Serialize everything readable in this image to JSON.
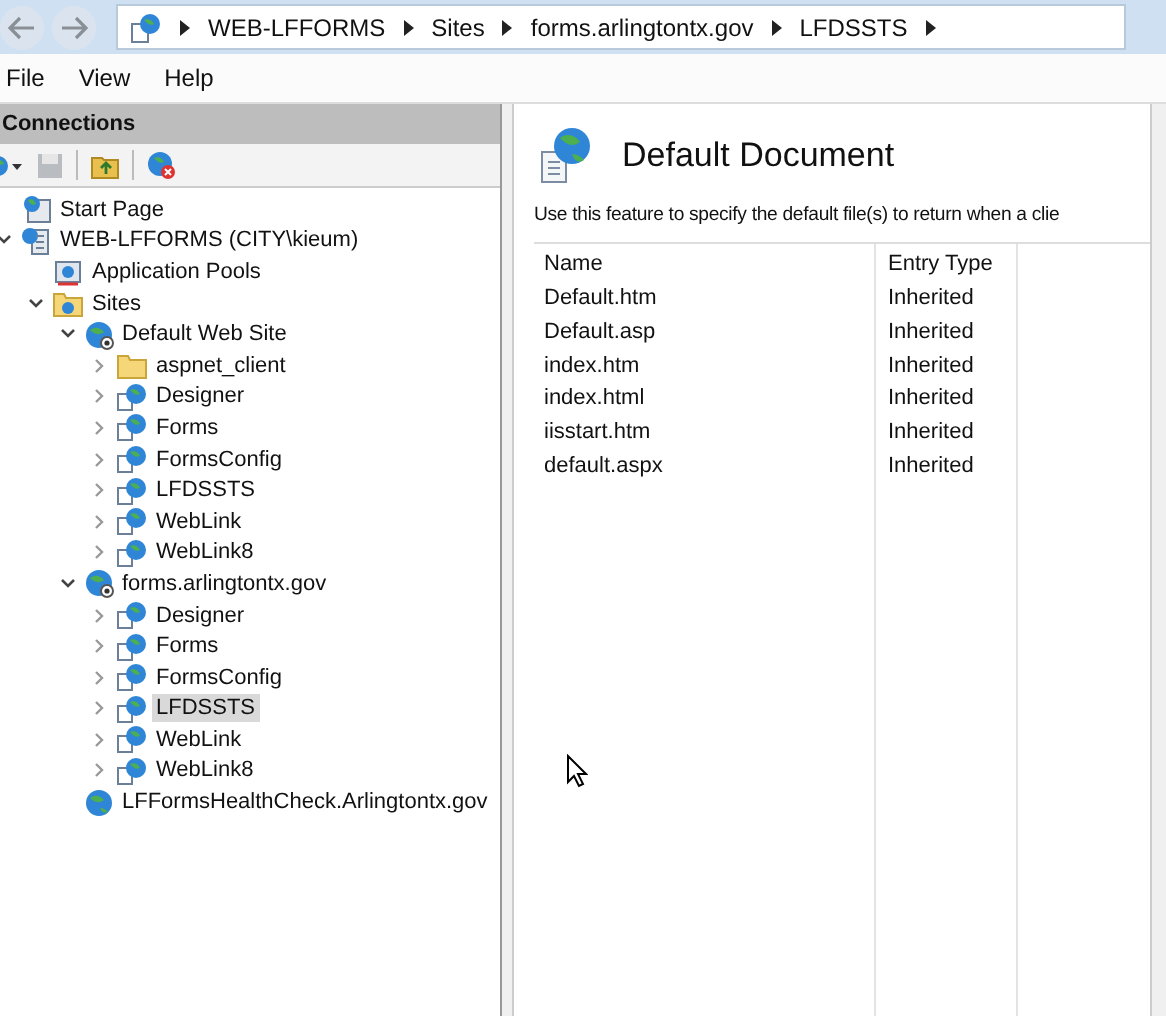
{
  "breadcrumb": [
    "WEB-LFFORMS",
    "Sites",
    "forms.arlingtontx.gov",
    "LFDSSTS"
  ],
  "menu": [
    "File",
    "View",
    "Help"
  ],
  "connections": {
    "title": "Connections",
    "tree": [
      {
        "label": "Start Page",
        "kind": "start",
        "selected": false
      },
      {
        "label": "WEB-LFFORMS (CITY\\kieum)",
        "kind": "server",
        "selected": false,
        "expanded": true,
        "children": [
          {
            "label": "Application Pools",
            "kind": "pools",
            "selected": false
          },
          {
            "label": "Sites",
            "kind": "sites",
            "selected": false,
            "expanded": true,
            "children": [
              {
                "label": "Default Web Site",
                "kind": "site",
                "selected": false,
                "expanded": true,
                "children": [
                  {
                    "label": "aspnet_client",
                    "kind": "folder",
                    "selected": false,
                    "expanded": false
                  },
                  {
                    "label": "Designer",
                    "kind": "app",
                    "selected": false,
                    "expanded": false
                  },
                  {
                    "label": "Forms",
                    "kind": "app",
                    "selected": false,
                    "expanded": false
                  },
                  {
                    "label": "FormsConfig",
                    "kind": "app",
                    "selected": false,
                    "expanded": false
                  },
                  {
                    "label": "LFDSSTS",
                    "kind": "app",
                    "selected": false,
                    "expanded": false
                  },
                  {
                    "label": "WebLink",
                    "kind": "app",
                    "selected": false,
                    "expanded": false
                  },
                  {
                    "label": "WebLink8",
                    "kind": "app",
                    "selected": false,
                    "expanded": false
                  }
                ]
              },
              {
                "label": "forms.arlingtontx.gov",
                "kind": "site",
                "selected": false,
                "expanded": true,
                "children": [
                  {
                    "label": "Designer",
                    "kind": "app",
                    "selected": false,
                    "expanded": false
                  },
                  {
                    "label": "Forms",
                    "kind": "app",
                    "selected": false,
                    "expanded": false
                  },
                  {
                    "label": "FormsConfig",
                    "kind": "app",
                    "selected": false,
                    "expanded": false
                  },
                  {
                    "label": "LFDSSTS",
                    "kind": "app",
                    "selected": true,
                    "expanded": false
                  },
                  {
                    "label": "WebLink",
                    "kind": "app",
                    "selected": false,
                    "expanded": false
                  },
                  {
                    "label": "WebLink8",
                    "kind": "app",
                    "selected": false,
                    "expanded": false
                  }
                ]
              },
              {
                "label": "LFFormsHealthCheck.Arlingtontx.gov",
                "kind": "globe",
                "selected": false
              }
            ]
          }
        ]
      }
    ]
  },
  "feature": {
    "title": "Default Document",
    "description": "Use this feature to specify the default file(s) to return when a clie",
    "columns": [
      "Name",
      "Entry Type"
    ],
    "rows": [
      [
        "Default.htm",
        "Inherited"
      ],
      [
        "Default.asp",
        "Inherited"
      ],
      [
        "index.htm",
        "Inherited"
      ],
      [
        "index.html",
        "Inherited"
      ],
      [
        "iisstart.htm",
        "Inherited"
      ],
      [
        "default.aspx",
        "Inherited"
      ]
    ]
  }
}
